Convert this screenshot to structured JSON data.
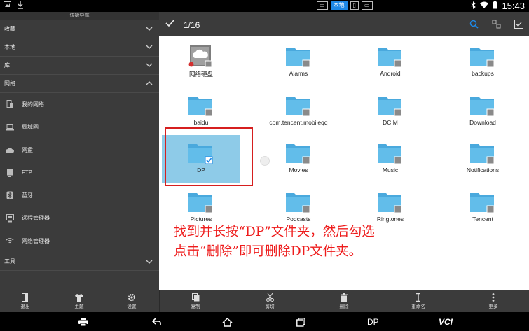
{
  "status_bar": {
    "time": "15:43",
    "storage_chips": [
      "本地"
    ],
    "active_chip": "本地"
  },
  "sidebar": {
    "header": "快捷导航",
    "sections": [
      {
        "label": "收藏"
      },
      {
        "label": "本地"
      },
      {
        "label": "库"
      },
      {
        "label": "网络",
        "expanded": true
      }
    ],
    "network_items": [
      {
        "label": "我的网络",
        "icon": "phone-icon"
      },
      {
        "label": "局域网",
        "icon": "laptop-icon"
      },
      {
        "label": "网盘",
        "icon": "cloud-icon"
      },
      {
        "label": "FTP",
        "icon": "server-icon"
      },
      {
        "label": "蓝牙",
        "icon": "bluetooth-icon"
      },
      {
        "label": "远程管理器",
        "icon": "remote-icon"
      },
      {
        "label": "网络管理器",
        "icon": "wifi-icon"
      }
    ],
    "tools": {
      "label": "工具"
    }
  },
  "toolbar": {
    "selection_count": "1/16"
  },
  "files": [
    {
      "name": "网络硬盘",
      "type": "netdisk"
    },
    {
      "name": "Alarms",
      "type": "folder"
    },
    {
      "name": "Android",
      "type": "folder"
    },
    {
      "name": "backups",
      "type": "folder"
    },
    {
      "name": "baidu",
      "type": "folder"
    },
    {
      "name": "com.tencent.mobileqq",
      "type": "folder"
    },
    {
      "name": "DCIM",
      "type": "folder"
    },
    {
      "name": "Download",
      "type": "folder"
    },
    {
      "name": "DP",
      "type": "folder",
      "selected": true
    },
    {
      "name": "Movies",
      "type": "folder"
    },
    {
      "name": "Music",
      "type": "folder"
    },
    {
      "name": "Notifications",
      "type": "folder"
    },
    {
      "name": "Pictures",
      "type": "folder"
    },
    {
      "name": "Podcasts",
      "type": "folder"
    },
    {
      "name": "Ringtones",
      "type": "folder"
    },
    {
      "name": "Tencent",
      "type": "folder"
    }
  ],
  "annotation": {
    "line1": "找到并长按“DP”文件夹，然后勾选",
    "line2": "点击“删除”即可删除DP文件夹。"
  },
  "actions_left": [
    {
      "label": "退出"
    },
    {
      "label": "主题"
    },
    {
      "label": "设置"
    }
  ],
  "actions_main": [
    {
      "label": "复制"
    },
    {
      "label": "剪切"
    },
    {
      "label": "删除"
    },
    {
      "label": "重命名"
    },
    {
      "label": "更多"
    }
  ],
  "nav_bar": {
    "dp_label": "DP",
    "vci_label": "VCI"
  },
  "colors": {
    "accent": "#1e88e5",
    "folder": "#5ab8e8",
    "selection": "#8ecbe8",
    "annotation": "#ee1c1c"
  }
}
